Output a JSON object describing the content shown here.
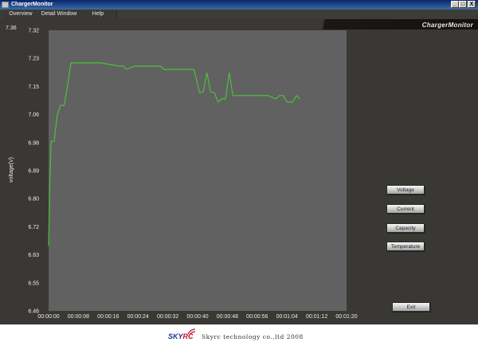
{
  "window": {
    "title": "ChargerMonitor",
    "brand": "ChargerMonitor"
  },
  "menu": [
    "Overview",
    "Detail Window",
    "Help"
  ],
  "window_controls": {
    "minimize": "_",
    "maximize": "□",
    "close": "X"
  },
  "buttons": {
    "voltage": "Voltage",
    "current": "Current",
    "capacity": "Capacity",
    "temperature": "Temperature",
    "exit": "Exit"
  },
  "footer": {
    "logo_sky": "SKY",
    "logo_rc": "RC",
    "copyright": "Skyrc technology co.,ltd 2008"
  },
  "colors": {
    "plot_bg": "#616161",
    "line": "#4cbf3c",
    "app_bg": "#3a3834"
  },
  "chart_data": {
    "type": "line",
    "title": "",
    "ylabel": "voltage(V)",
    "xlabel": "",
    "ylim": [
      6.46,
      7.32
    ],
    "y_top_label": "7.36",
    "y_ticks": [
      "7.32",
      "7.23",
      "7.15",
      "7.06",
      "6.98",
      "6.89",
      "6.80",
      "6.72",
      "6.63",
      "6.55",
      "6.46"
    ],
    "x_ticks": [
      "00:00:00",
      "00:00:08",
      "00:00:16",
      "00:00:24",
      "00:00:32",
      "00:00:40",
      "00:00:48",
      "00:00:56",
      "00:01:04",
      "00:01:12",
      "00:01:20"
    ],
    "xlim_seconds": [
      0,
      80
    ],
    "series": [
      {
        "x": [
          0,
          0.3,
          0.7,
          1.5,
          2.3,
          3.2,
          4.2,
          5.1,
          6.0,
          6.8,
          7.6,
          8.5,
          14,
          19,
          20,
          21,
          23,
          24,
          26,
          28,
          30,
          31,
          33,
          34,
          35,
          36,
          38,
          39,
          39.7,
          40.5,
          41.5,
          42.5,
          43.5,
          44.5,
          45.5,
          46.5,
          47.5,
          48.5,
          49.5,
          50,
          51,
          55,
          57,
          59,
          61,
          62,
          63,
          64,
          65,
          65.5,
          66.5,
          67.5
        ],
        "y": [
          6.66,
          6.84,
          6.98,
          6.98,
          7.06,
          7.09,
          7.09,
          7.15,
          7.22,
          7.22,
          7.22,
          7.22,
          7.22,
          7.21,
          7.21,
          7.2,
          7.21,
          7.21,
          7.21,
          7.21,
          7.21,
          7.2,
          7.2,
          7.2,
          7.2,
          7.2,
          7.2,
          7.2,
          7.17,
          7.13,
          7.13,
          7.19,
          7.13,
          7.13,
          7.1,
          7.11,
          7.11,
          7.19,
          7.12,
          7.12,
          7.12,
          7.12,
          7.12,
          7.12,
          7.11,
          7.12,
          7.12,
          7.1,
          7.1,
          7.1,
          7.12,
          7.11
        ]
      }
    ]
  }
}
